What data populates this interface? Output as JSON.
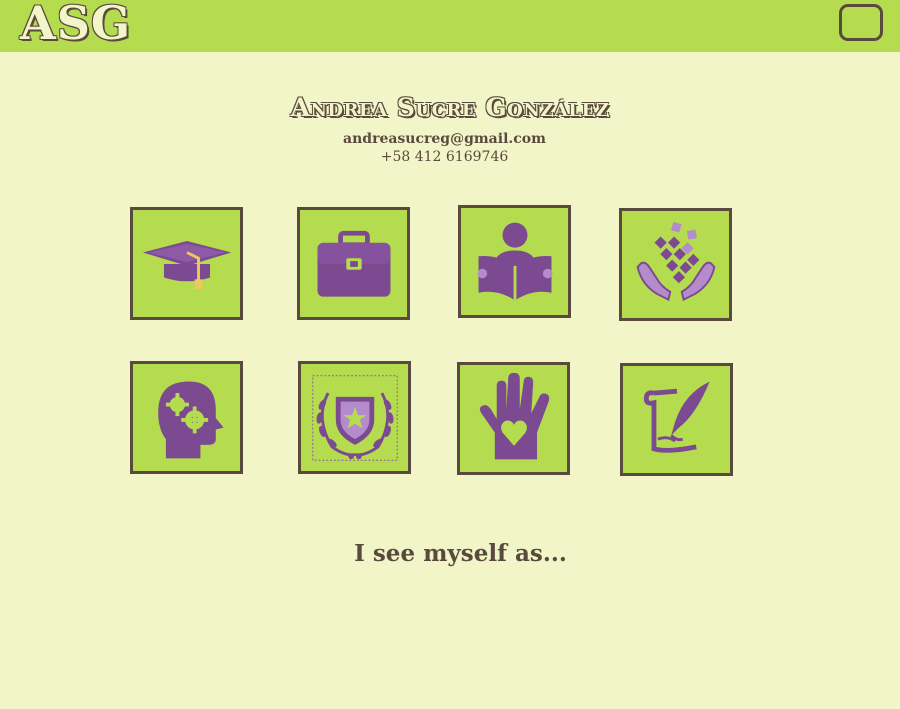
{
  "header": {
    "logo_text": "ASG",
    "menu_button_label": ""
  },
  "profile": {
    "name": "Andrea Sucre González",
    "email": "andreasucreg@gmail.com",
    "phone": "+58 412 6169746"
  },
  "tiles": [
    {
      "icon": "graduation-cap-icon"
    },
    {
      "icon": "briefcase-icon"
    },
    {
      "icon": "reader-icon"
    },
    {
      "icon": "hands-cubes-icon"
    },
    {
      "icon": "head-gears-icon"
    },
    {
      "icon": "laurel-shield-icon"
    },
    {
      "icon": "hand-heart-icon"
    },
    {
      "icon": "quill-scroll-icon"
    }
  ],
  "tagline": "I see myself as...",
  "colors": {
    "background": "#f1f5c7",
    "accent_green": "#b4dc4e",
    "icon_purple": "#7b4a91",
    "icon_light_purple": "#b48bcb",
    "border_brown": "#5a4a3e"
  }
}
